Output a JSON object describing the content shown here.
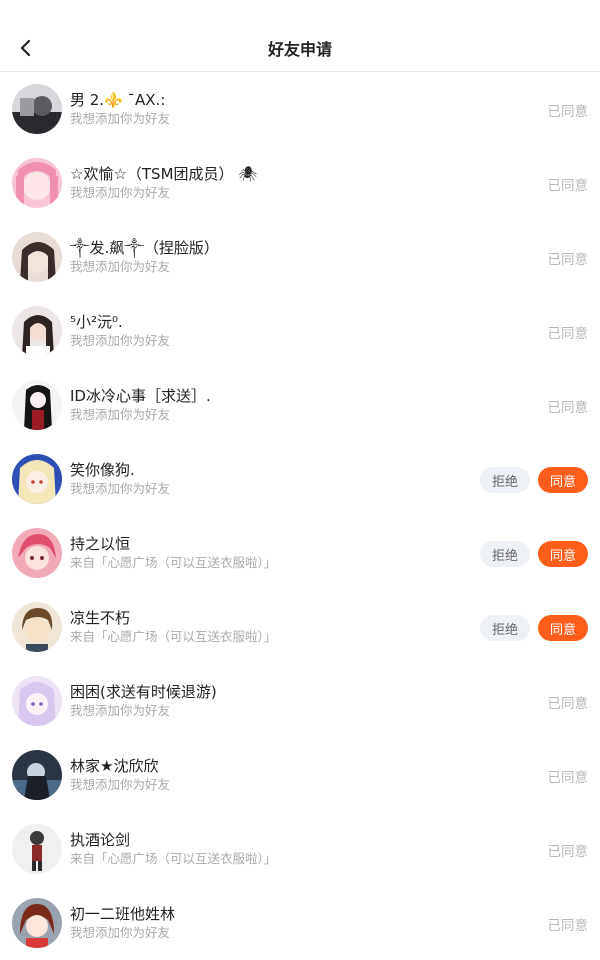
{
  "header": {
    "title": "好友申请"
  },
  "colors": {
    "accent": "#ff5e1a",
    "reject_bg": "#eef1f5",
    "muted_text": "#aaaaaa"
  },
  "requests": [
    {
      "name": "男  2.⚜️ ¯AX.:",
      "message": "我想添加你为好友",
      "status": "已同意"
    },
    {
      "name": "☆欢愉☆（TSM团成员） 🕷",
      "message": "我想添加你为好友",
      "status": "已同意"
    },
    {
      "name": "༒发.飙༒（捏脸版）",
      "message": "我想添加你为好友",
      "status": "已同意"
    },
    {
      "name": "⁵小²沅⁰.",
      "message": "我想添加你为好友",
      "status": "已同意"
    },
    {
      "name": "ID冰冷心事［求送］.",
      "message": "我想添加你为好友",
      "status": "已同意"
    },
    {
      "name": "笑你像狗.",
      "message": "我想添加你为好友",
      "reject_label": "拒绝",
      "accept_label": "同意"
    },
    {
      "name": "持之以恒",
      "message": "来自「心愿广场（可以互送衣服啦）」",
      "reject_label": "拒绝",
      "accept_label": "同意"
    },
    {
      "name": "凉生不朽",
      "message": "来自「心愿广场（可以互送衣服啦）」",
      "reject_label": "拒绝",
      "accept_label": "同意"
    },
    {
      "name": "困困(求送有时候退游)",
      "message": "我想添加你为好友",
      "status": "已同意"
    },
    {
      "name": "林家★沈欣欣",
      "message": "我想添加你为好友",
      "status": "已同意"
    },
    {
      "name": "执酒论剑",
      "message": "来自「心愿广场（可以互送衣服啦）」",
      "status": "已同意"
    },
    {
      "name": "初一二班他姓林",
      "message": "我想添加你为好友",
      "status": "已同意"
    }
  ]
}
